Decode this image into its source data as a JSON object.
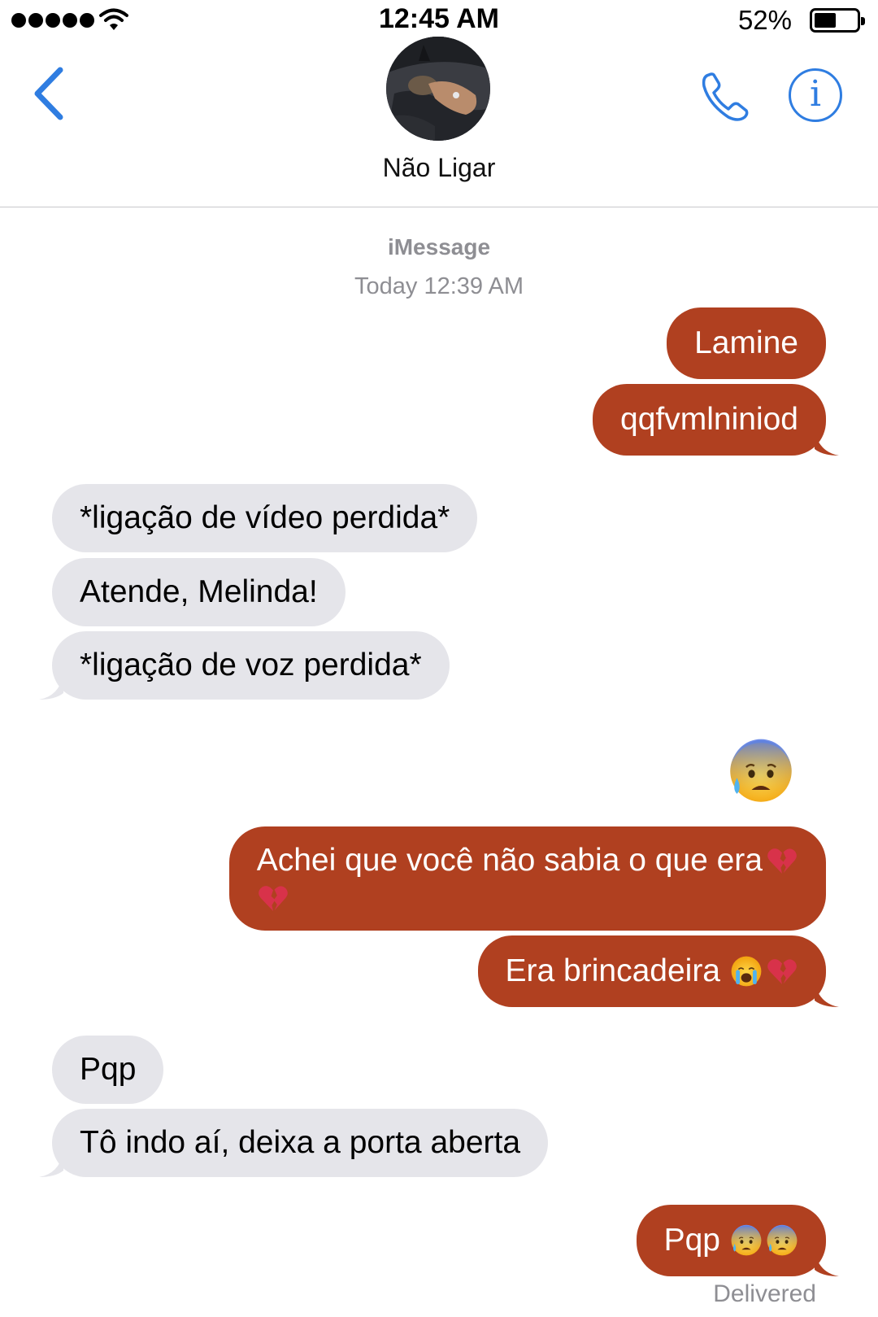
{
  "status_bar": {
    "time": "12:45 AM",
    "battery_percent": "52%",
    "battery_level": 0.52,
    "signal_icon": "signal-dots-icon",
    "wifi_icon": "wifi-icon"
  },
  "header": {
    "contact_name": "Não Ligar",
    "back_icon": "chevron-left-icon",
    "call_icon": "phone-icon",
    "info_icon": "info-icon",
    "info_glyph": "i",
    "accent_color": "#2f7de1"
  },
  "thread": {
    "service": "iMessage",
    "timestamp": "Today 12:39 AM",
    "sent_color": "#b04020",
    "received_color": "#e5e5ea",
    "messages": [
      {
        "from": "me",
        "text": "Lamine"
      },
      {
        "from": "me",
        "text": "qqfvmlniniod"
      },
      {
        "from": "them",
        "text": "*ligação de vídeo perdida*"
      },
      {
        "from": "them",
        "text": "Atende, Melinda!"
      },
      {
        "from": "them",
        "text": "*ligação de voz perdida*"
      },
      {
        "from": "me",
        "emoji": "anxious-face-with-sweat-icon"
      },
      {
        "from": "me",
        "text_line1": "Achei que você não sabia o que era",
        "emojis": [
          "broken-heart-icon",
          "broken-heart-icon"
        ]
      },
      {
        "from": "me",
        "text": "Era brincadeira",
        "emojis": [
          "loudly-crying-face-icon",
          "broken-heart-icon"
        ]
      },
      {
        "from": "them",
        "text": "Pqp"
      },
      {
        "from": "them",
        "text": "Tô indo aí, deixa a porta aberta"
      },
      {
        "from": "me",
        "text": "Pqp",
        "emojis": [
          "anxious-face-with-sweat-icon",
          "anxious-face-with-sweat-icon"
        ]
      }
    ],
    "delivery_status": "Delivered"
  }
}
